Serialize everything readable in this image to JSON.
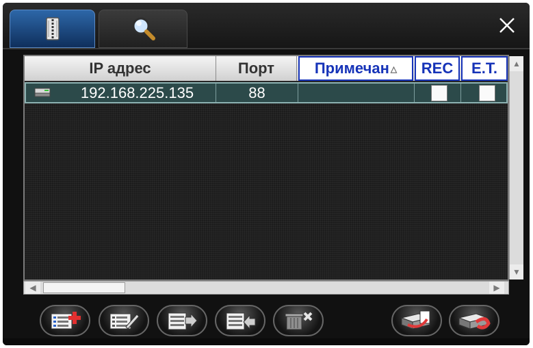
{
  "tabs": [
    {
      "name": "address-book-tab",
      "icon": "address-book-icon",
      "active": true
    },
    {
      "name": "search-tab",
      "icon": "search-icon",
      "active": false
    }
  ],
  "table": {
    "columns": [
      {
        "label": "IP адрес"
      },
      {
        "label": "Порт"
      },
      {
        "label": "Примечан",
        "sorted": true
      },
      {
        "label": "REC"
      },
      {
        "label": "E.T."
      }
    ],
    "rows": [
      {
        "icon": "dvr-device-icon",
        "ip": "192.168.225.135",
        "port": "88",
        "note": "",
        "rec": false,
        "et": false
      }
    ]
  },
  "toolbar": [
    {
      "icon": "add-device-icon"
    },
    {
      "icon": "edit-device-icon"
    },
    {
      "icon": "export-list-icon"
    },
    {
      "icon": "import-list-icon"
    },
    {
      "icon": "delete-device-icon"
    },
    {
      "icon": "connect-device-icon"
    },
    {
      "icon": "disconnect-device-icon"
    }
  ],
  "colors": {
    "tab_active": "#2d67a8",
    "row_selected": "#2c4a4a",
    "header_selected": "#1633b8"
  }
}
